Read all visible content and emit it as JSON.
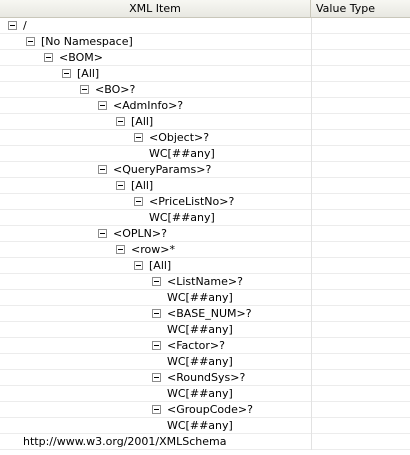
{
  "header": {
    "xml_item": "XML Item",
    "value_type": "Value Type"
  },
  "tree": [
    {
      "label": "/",
      "expanded": true
    },
    {
      "label": "[No Namespace]",
      "expanded": true
    },
    {
      "label": "<BOM>",
      "expanded": true
    },
    {
      "label": "[All]",
      "expanded": true
    },
    {
      "label": "<BO>?",
      "expanded": true
    },
    {
      "label": "<AdmInfo>?",
      "expanded": true
    },
    {
      "label": "[All]",
      "expanded": true
    },
    {
      "label": "<Object>?",
      "expanded": true
    },
    {
      "label": "WC[##any]",
      "expanded": false
    },
    {
      "label": "<QueryParams>?",
      "expanded": true
    },
    {
      "label": "[All]",
      "expanded": true
    },
    {
      "label": "<PriceListNo>?",
      "expanded": true
    },
    {
      "label": "WC[##any]",
      "expanded": false
    },
    {
      "label": "<OPLN>?",
      "expanded": true
    },
    {
      "label": "<row>*",
      "expanded": true
    },
    {
      "label": "[All]",
      "expanded": true
    },
    {
      "label": "<ListName>?",
      "expanded": true
    },
    {
      "label": "WC[##any]",
      "expanded": false
    },
    {
      "label": "<BASE_NUM>?",
      "expanded": true
    },
    {
      "label": "WC[##any]",
      "expanded": false
    },
    {
      "label": "<Factor>?",
      "expanded": true
    },
    {
      "label": "WC[##any]",
      "expanded": false
    },
    {
      "label": "<RoundSys>?",
      "expanded": true
    },
    {
      "label": "WC[##any]",
      "expanded": false
    },
    {
      "label": "<GroupCode>?",
      "expanded": true
    },
    {
      "label": "WC[##any]",
      "expanded": false
    },
    {
      "label": "http://www.w3.org/2001/XMLSchema",
      "expanded": false
    }
  ]
}
